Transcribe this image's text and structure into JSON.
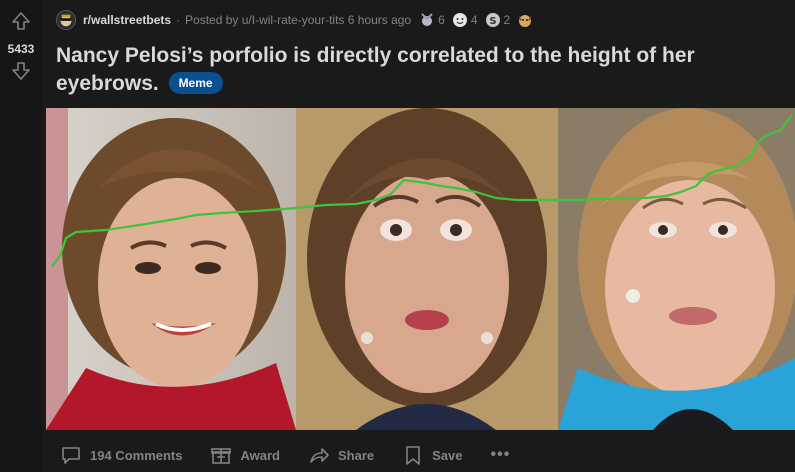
{
  "vote": {
    "count": "5433"
  },
  "meta": {
    "subreddit": "r/wallstreetbets",
    "separator": "·",
    "posted_by": "Posted by u/I-wil-rate-your-tits 6 hours ago",
    "awards": [
      {
        "icon": "award-medal-icon",
        "count": "6"
      },
      {
        "icon": "award-wholesome-icon",
        "count": "4"
      },
      {
        "icon": "award-silver-icon",
        "count": "2"
      },
      {
        "icon": "award-dog-icon",
        "count": ""
      }
    ]
  },
  "post": {
    "title": "Nancy Pelosi’s porfolio is directly correlated to the height of her eyebrows.",
    "flair": "Meme"
  },
  "colors": {
    "background": "#1a1a1b",
    "flair": "#0a4f8f",
    "trend_line": "#3ec43a",
    "muted_text": "#818384"
  },
  "actions": {
    "comments": "194 Comments",
    "award": "Award",
    "share": "Share",
    "save": "Save",
    "more": "•••"
  }
}
